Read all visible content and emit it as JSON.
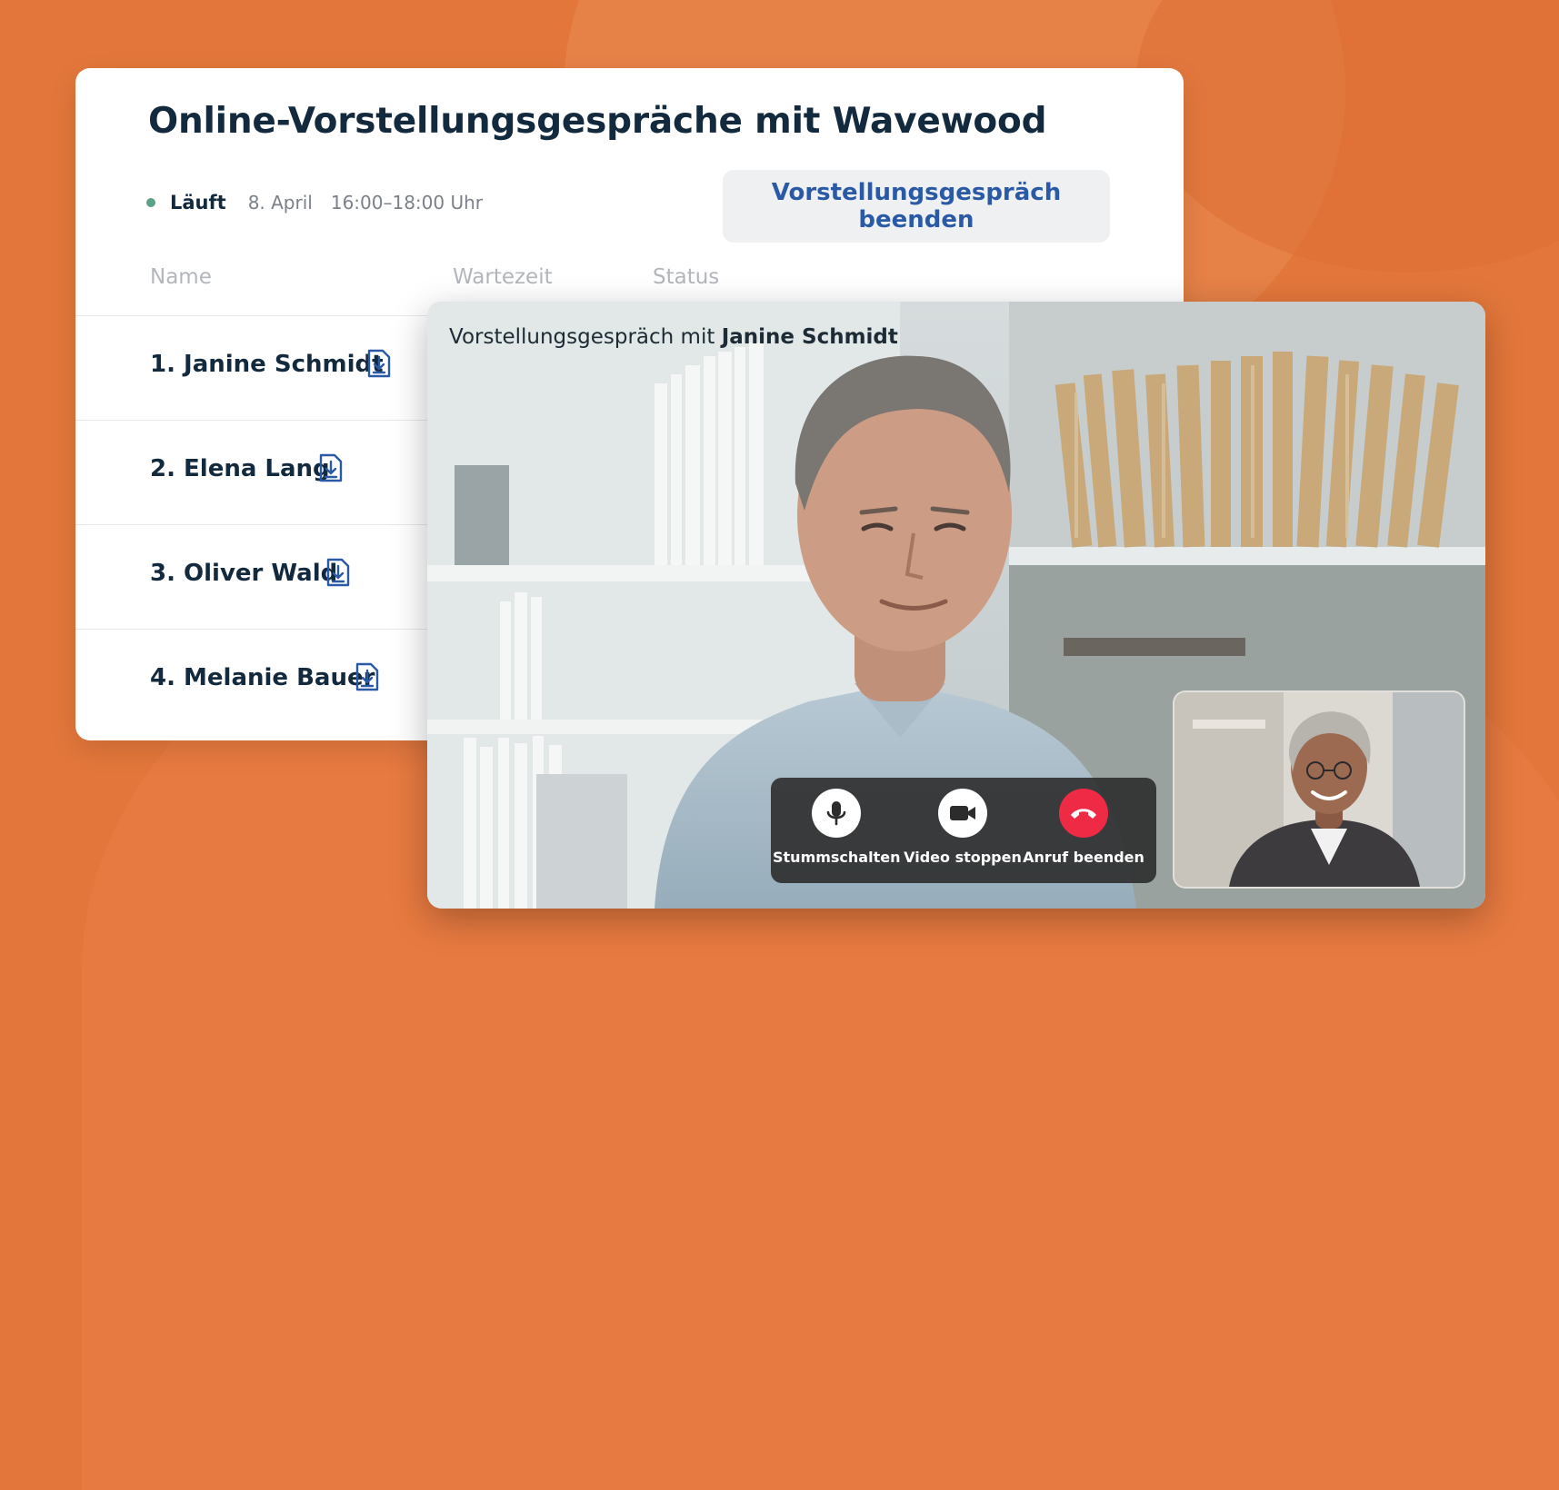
{
  "panel": {
    "title": "Online-Vorstellungsgespräche mit Wavewood",
    "status": "Läuft",
    "date": "8. April",
    "time": "16:00–18:00 Uhr",
    "end_button": "Vorstellungsgespräch beenden",
    "columns": {
      "name": "Name",
      "wait": "Wartezeit",
      "status": "Status"
    },
    "candidates": [
      {
        "label": "1. Janine Schmidt"
      },
      {
        "label": "2. Elena Lang"
      },
      {
        "label": "3. Oliver Wald"
      },
      {
        "label": "4. Melanie Bauer"
      }
    ]
  },
  "video": {
    "caption_prefix": "Vorstellungsgespräch mit",
    "caption_name": "Janine Schmidt",
    "controls": {
      "mute": "Stummschalten",
      "video": "Video stoppen",
      "end_call": "Anruf beenden"
    }
  },
  "colors": {
    "background": "#e3773b",
    "title": "#13293d",
    "accent_blue": "#2a5aa6",
    "status_green": "#5aa186",
    "end_call_red": "#ee2a45"
  },
  "icons": [
    "document-download-icon",
    "microphone-icon",
    "video-camera-icon",
    "phone-hangup-icon"
  ]
}
